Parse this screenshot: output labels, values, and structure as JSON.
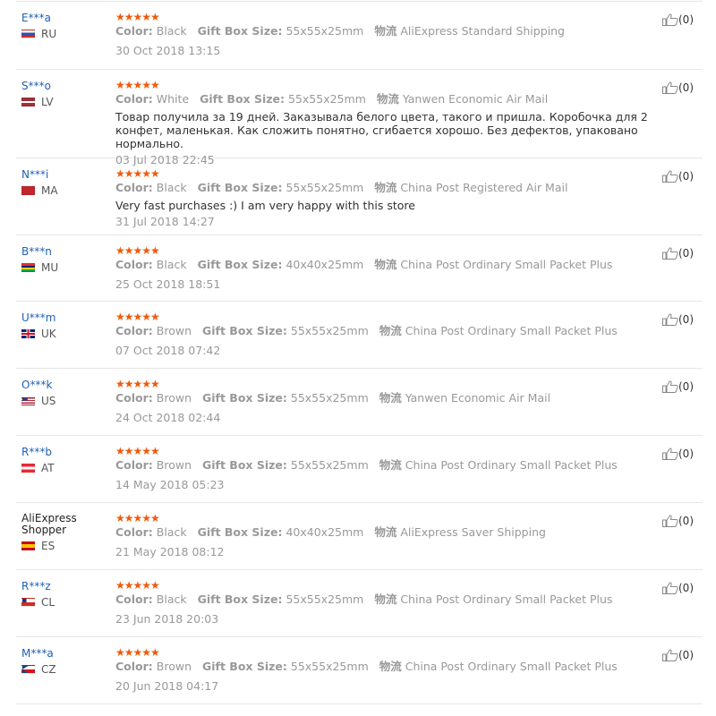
{
  "labels": {
    "color": "Color:",
    "gift_box_size": "Gift Box Size:",
    "logistics": "物流"
  },
  "stars": "★★★★★",
  "reviews": [
    {
      "user": "E***a",
      "country": "RU",
      "flag": "ru",
      "color": "Black",
      "size": "55x55x25mm",
      "shipping": "AliExpress Standard Shipping",
      "date": "30 Oct 2018 13:15",
      "helpful": "(0)"
    },
    {
      "user": "S***o",
      "country": "LV",
      "flag": "lv",
      "color": "White",
      "size": "55x55x25mm",
      "shipping": "Yanwen Economic Air Mail",
      "feedback": "Товар получила за 19 дней. Заказывала белого цвета, такого и пришла. Коробочка для 2 конфет, маленькая. Как сложить понятно, сгибается хорошо. Без дефектов, упаковано нормально.",
      "date": "03 Jul 2018 22:45",
      "helpful": "(0)"
    },
    {
      "user": "N***i",
      "country": "MA",
      "flag": "ma",
      "color": "Black",
      "size": "55x55x25mm",
      "shipping": "China Post Registered Air Mail",
      "feedback": "Very fast purchases :) I am very happy with this store",
      "date": "31 Jul 2018 14:27",
      "helpful": "(0)"
    },
    {
      "user": "B***n",
      "country": "MU",
      "flag": "mu",
      "color": "Black",
      "size": "40x40x25mm",
      "shipping": "China Post Ordinary Small Packet Plus",
      "date": "25 Oct 2018 18:51",
      "helpful": "(0)"
    },
    {
      "user": "U***m",
      "country": "UK",
      "flag": "uk",
      "color": "Brown",
      "size": "55x55x25mm",
      "shipping": "China Post Ordinary Small Packet Plus",
      "date": "07 Oct 2018 07:42",
      "helpful": "(0)"
    },
    {
      "user": "O***k",
      "country": "US",
      "flag": "us",
      "color": "Brown",
      "size": "55x55x25mm",
      "shipping": "Yanwen Economic Air Mail",
      "date": "24 Oct 2018 02:44",
      "helpful": "(0)"
    },
    {
      "user": "R***b",
      "country": "AT",
      "flag": "at",
      "color": "Brown",
      "size": "55x55x25mm",
      "shipping": "China Post Ordinary Small Packet Plus",
      "date": "14 May 2018 05:23",
      "helpful": "(0)"
    },
    {
      "user": "AliExpress Shopper",
      "country": "ES",
      "flag": "es",
      "color": "Black",
      "size": "40x40x25mm",
      "shipping": "AliExpress Saver Shipping",
      "date": "21 May 2018 08:12",
      "helpful": "(0)"
    },
    {
      "user": "R***z",
      "country": "CL",
      "flag": "cl",
      "color": "Black",
      "size": "55x55x25mm",
      "shipping": "China Post Ordinary Small Packet Plus",
      "date": "23 Jun 2018 20:03",
      "helpful": "(0)"
    },
    {
      "user": "M***a",
      "country": "CZ",
      "flag": "cz",
      "color": "Brown",
      "size": "55x55x25mm",
      "shipping": "China Post Ordinary Small Packet Plus",
      "date": "20 Jun 2018 04:17",
      "helpful": "(0)"
    }
  ]
}
